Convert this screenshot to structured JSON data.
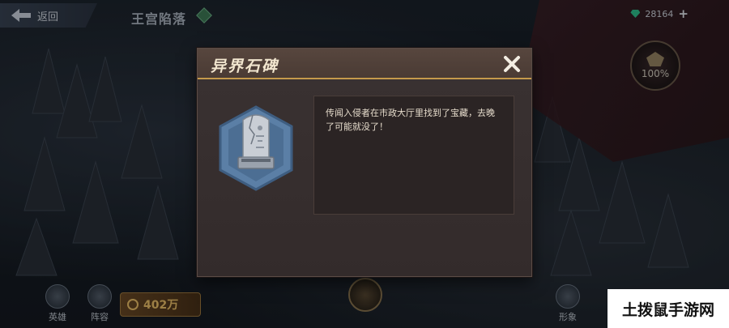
{
  "hud": {
    "back_label": "返回",
    "stage_title": "王宫陷落",
    "currency_value": "28164",
    "currency_plus": "+",
    "progress_percent": "100%"
  },
  "bottom": {
    "heroes_label": "英雄",
    "formation_label": "阵容",
    "gold_amount": "402万",
    "right_label": "形象"
  },
  "modal": {
    "title": "异界石碑",
    "description": "传闻入侵者在市政大厅里找到了宝藏，去晚了可能就没了！"
  },
  "watermark": {
    "text": "土拨鼠手游网"
  },
  "colors": {
    "accent_gold": "#c59a4b",
    "modal_bg": "#332b2b",
    "currency_gem": "#2fc48f"
  },
  "icons": [
    "back-arrow-icon",
    "stage-gem-icon",
    "diamond-icon",
    "plus-icon",
    "crest-icon",
    "close-icon",
    "monument-icon",
    "hero-icon",
    "formation-icon",
    "coin-icon",
    "emblem-icon"
  ]
}
